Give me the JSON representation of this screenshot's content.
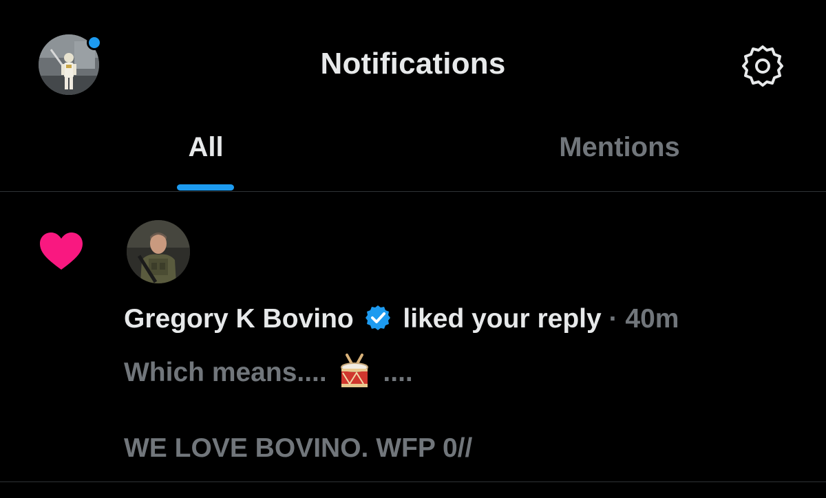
{
  "header": {
    "title": "Notifications",
    "avatar_icon": "user-avatar",
    "settings_icon": "gear-icon",
    "presence_color": "#1d9bf0"
  },
  "tabs": [
    {
      "label": "All",
      "active": true
    },
    {
      "label": "Mentions",
      "active": false
    }
  ],
  "accent_color": "#1d9bf0",
  "notification": {
    "type_icon": "heart-icon",
    "type_color": "#f91880",
    "user_name": "Gregory K Bovino",
    "verified_icon": "verified-badge-icon",
    "action": "liked your reply",
    "separator": "·",
    "time": "40m",
    "preview_before_emoji": "Which means....",
    "emoji_icon": "drum-emoji",
    "preview_after_emoji": "....",
    "preview_line2": "WE LOVE BOVINO. WFP 0//"
  }
}
